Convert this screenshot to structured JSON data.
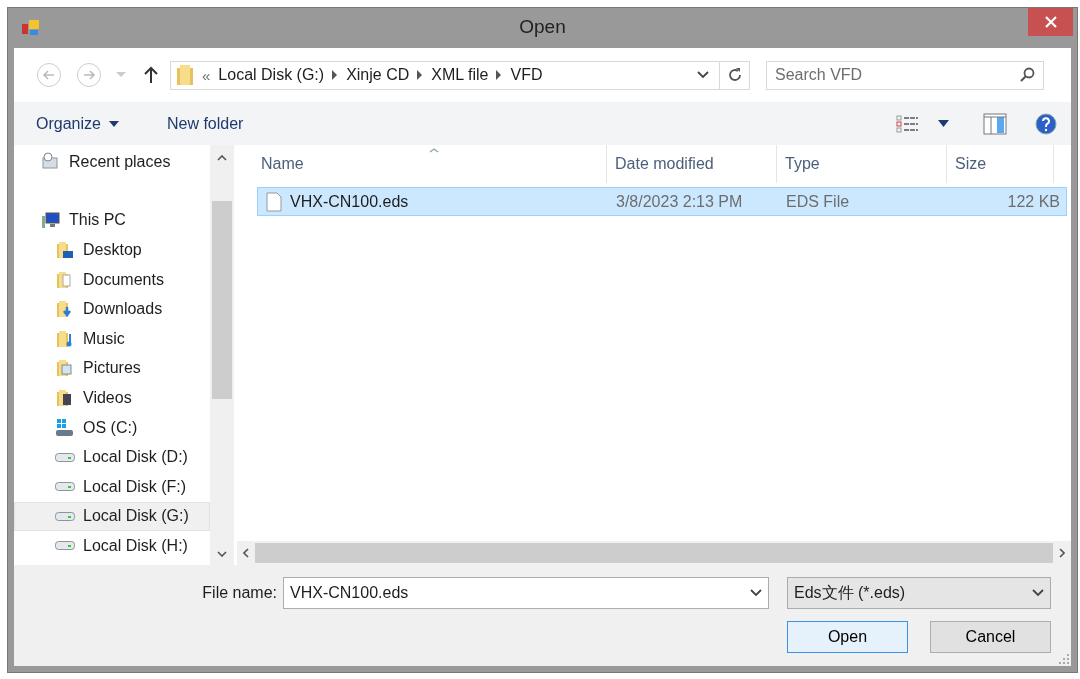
{
  "window": {
    "title": "Open"
  },
  "address": {
    "overflow": "«",
    "crumbs": [
      "Local Disk (G:)",
      "Xinje CD",
      "XML file",
      "VFD"
    ]
  },
  "search": {
    "placeholder": "Search VFD"
  },
  "toolbar": {
    "buttons": [
      "Organize",
      "New folder"
    ]
  },
  "sidebar": {
    "items": [
      {
        "label": "Recent places",
        "kind": "recent",
        "selected": false
      },
      {
        "label": "This PC",
        "kind": "pc",
        "selected": false,
        "children": [
          {
            "label": "Desktop",
            "kind": "desktop",
            "selected": false
          },
          {
            "label": "Documents",
            "kind": "documents",
            "selected": false
          },
          {
            "label": "Downloads",
            "kind": "downloads",
            "selected": false
          },
          {
            "label": "Music",
            "kind": "music",
            "selected": false
          },
          {
            "label": "Pictures",
            "kind": "pictures",
            "selected": false
          },
          {
            "label": "Videos",
            "kind": "videos",
            "selected": false
          },
          {
            "label": "OS (C:)",
            "kind": "os-drive",
            "selected": false
          },
          {
            "label": "Local Disk (D:)",
            "kind": "drive",
            "selected": false
          },
          {
            "label": "Local Disk (F:)",
            "kind": "drive",
            "selected": false
          },
          {
            "label": "Local Disk (G:)",
            "kind": "drive",
            "selected": true
          },
          {
            "label": "Local Disk (H:)",
            "kind": "drive",
            "selected": false
          }
        ]
      }
    ]
  },
  "table": {
    "columns": [
      "Name",
      "Date modified",
      "Type",
      "Size"
    ],
    "rows": [
      {
        "cells": [
          "VHX-CN100.eds",
          "3/8/2023 2:13 PM",
          "EDS File",
          "122 KB"
        ],
        "selected": true
      }
    ]
  },
  "file_name": {
    "label": "File name:",
    "value": "VHX-CN100.eds"
  },
  "file_type": {
    "value": "Eds文件 (*.eds)"
  },
  "buttons": [
    "Open",
    "Cancel"
  ]
}
